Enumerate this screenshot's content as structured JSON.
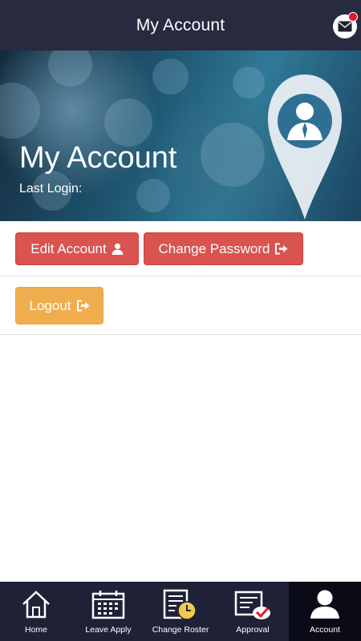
{
  "header": {
    "title": "My Account",
    "mail_icon": "mail-notification-icon"
  },
  "banner": {
    "title": "My Account",
    "last_login_label": "Last Login:",
    "pin_icon": "user-location-pin-icon"
  },
  "actions": {
    "edit_account": "Edit Account",
    "change_password": "Change Password",
    "logout": "Logout"
  },
  "nav": {
    "items": [
      {
        "label": "Home",
        "icon": "home-icon"
      },
      {
        "label": "Leave Apply",
        "icon": "calendar-icon"
      },
      {
        "label": "Change Roster",
        "icon": "roster-clock-icon"
      },
      {
        "label": "Approval",
        "icon": "approval-check-icon"
      },
      {
        "label": "Account",
        "icon": "user-icon",
        "active": true
      }
    ]
  },
  "colors": {
    "topbar": "#282a40",
    "danger": "#d9534f",
    "warning": "#f0ad4e",
    "nav_bg": "#1f2137",
    "nav_active": "#0a0b16"
  }
}
